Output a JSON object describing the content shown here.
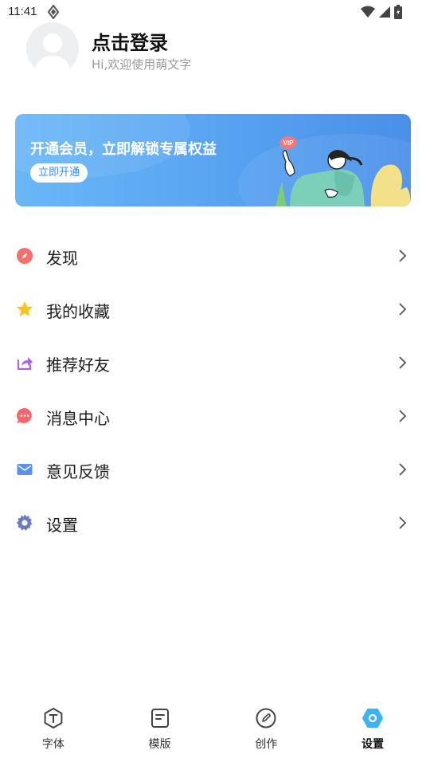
{
  "status": {
    "time": "11:41"
  },
  "profile": {
    "title": "点击登录",
    "subtitle": "Hi,欢迎使用萌文字"
  },
  "vip": {
    "title": "开通会员，立即解锁专属权益",
    "button": "立即开通",
    "badge": "VIP"
  },
  "menu": [
    {
      "label": "发现",
      "icon": "compass-icon",
      "color": "#f4706b"
    },
    {
      "label": "我的收藏",
      "icon": "star-icon",
      "color": "#f7c320"
    },
    {
      "label": "推荐好友",
      "icon": "share-icon",
      "color": "#b35cf0"
    },
    {
      "label": "消息中心",
      "icon": "message-icon",
      "color": "#f4666a"
    },
    {
      "label": "意见反馈",
      "icon": "mail-icon",
      "color": "#5e8ff3"
    },
    {
      "label": "设置",
      "icon": "gear-icon",
      "color": "#6a7fba"
    }
  ],
  "tabs": [
    {
      "label": "字体",
      "icon": "font-icon"
    },
    {
      "label": "模版",
      "icon": "template-icon"
    },
    {
      "label": "创作",
      "icon": "pen-icon"
    },
    {
      "label": "设置",
      "icon": "settings-hex-icon",
      "active": true
    }
  ],
  "colors": {
    "accent": "#3d8eea",
    "active_tab": "#3cb2f3"
  }
}
